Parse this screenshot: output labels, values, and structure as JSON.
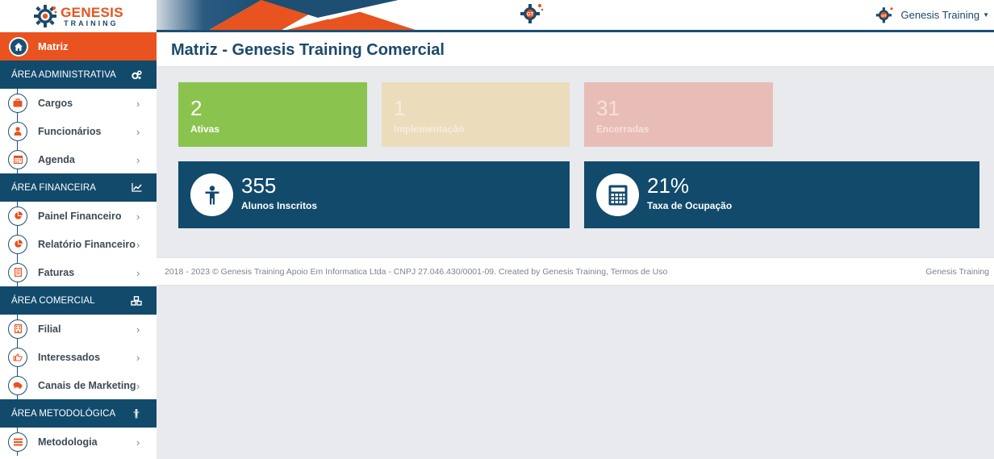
{
  "brand": {
    "logo_line1": "GENESIS",
    "logo_line2": "TRAINING",
    "orange": "#e8531f",
    "navy": "#124a6c"
  },
  "header": {
    "user_name": "Genesis Training",
    "user_caret_icon": "caret-down-icon",
    "center_icon": "gt-gear-logo-icon"
  },
  "sidebar": {
    "active": {
      "label": "Matriz",
      "icon": "home-icon"
    },
    "sections": [
      {
        "title": "ÁREA ADMINISTRATIVA",
        "icon": "cogs-icon",
        "items": [
          {
            "label": "Cargos",
            "icon": "briefcase-icon"
          },
          {
            "label": "Funcionários",
            "icon": "user-icon"
          },
          {
            "label": "Agenda",
            "icon": "calendar-icon"
          }
        ]
      },
      {
        "title": "ÁREA FINANCEIRA",
        "icon": "line-chart-icon",
        "items": [
          {
            "label": "Painel Financeiro",
            "icon": "pie-chart-icon"
          },
          {
            "label": "Relatório Financeiro",
            "icon": "pie-chart-icon"
          },
          {
            "label": "Faturas",
            "icon": "document-icon"
          }
        ]
      },
      {
        "title": "ÁREA COMERCIAL",
        "icon": "cubes-icon",
        "items": [
          {
            "label": "Filial",
            "icon": "building-icon"
          },
          {
            "label": "Interessados",
            "icon": "hand-pointer-icon"
          },
          {
            "label": "Canais de Marketing",
            "icon": "comments-icon"
          }
        ]
      },
      {
        "title": "ÁREA METODOLÓGICA",
        "icon": "child-icon",
        "items": [
          {
            "label": "Metodologia",
            "icon": "list-icon"
          }
        ]
      }
    ]
  },
  "main": {
    "title": "Matriz - Genesis Training Comercial",
    "status_cards": [
      {
        "value": "2",
        "label": "Ativas",
        "color": "#8bc34f"
      },
      {
        "value": "1",
        "label": "Implementação",
        "color": "#ebdcbb"
      },
      {
        "value": "31",
        "label": "Encerradas",
        "color": "#e8bdb7"
      }
    ],
    "stat_cards": [
      {
        "value": "355",
        "label": "Alunos Inscritos",
        "icon": "child-icon"
      },
      {
        "value": "21%",
        "label": "Taxa de Ocupação",
        "icon": "calculator-icon"
      }
    ]
  },
  "footer": {
    "left": "2018 - 2023 © Genesis Training Apoio Em Informatica Ltda - CNPJ 27.046.430/0001-09. Created by Genesis Training, Termos de Uso",
    "right": "Genesis Training"
  }
}
